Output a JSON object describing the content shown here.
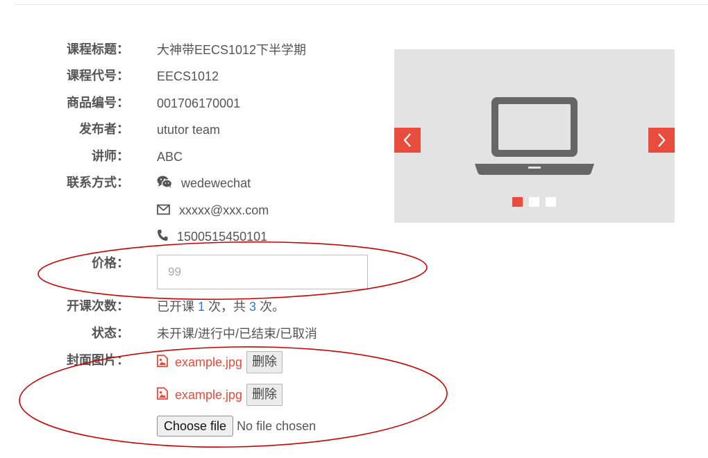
{
  "fields": {
    "title": {
      "label": "课程标题：",
      "value": "大神带EECS1012下半学期"
    },
    "code": {
      "label": "课程代号：",
      "value": "EECS1012"
    },
    "product_no": {
      "label": "商品编号：",
      "value": "001706170001"
    },
    "publisher": {
      "label": "发布者：",
      "value": "ututor team"
    },
    "lecturer": {
      "label": "讲师：",
      "value": "ABC"
    },
    "contact": {
      "label": "联系方式：",
      "wechat": "wedewechat",
      "email": "xxxxx@xxx.com",
      "phone": "1500515450101"
    },
    "price": {
      "label": "价格：",
      "placeholder": "99"
    },
    "sessions": {
      "label": "开课次数：",
      "prefix": "已开课 ",
      "done": "1",
      "middle": " 次，共 ",
      "total": "3",
      "suffix": " 次。"
    },
    "status": {
      "label": "状态：",
      "value": "未开课/进行中/已结束/已取消"
    },
    "cover": {
      "label": "封面图片：",
      "files": [
        {
          "name": "example.jpg",
          "delete_label": "删除"
        },
        {
          "name": "example.jpg",
          "delete_label": "删除"
        }
      ],
      "choose_label": "Choose file",
      "no_file_text": "No file chosen"
    }
  },
  "carousel": {
    "image_icon": "laptop-icon",
    "slide_count": 3,
    "active_slide": 1,
    "accent_color": "#e84c3d"
  },
  "annotations": {
    "color": "#cc0000"
  }
}
